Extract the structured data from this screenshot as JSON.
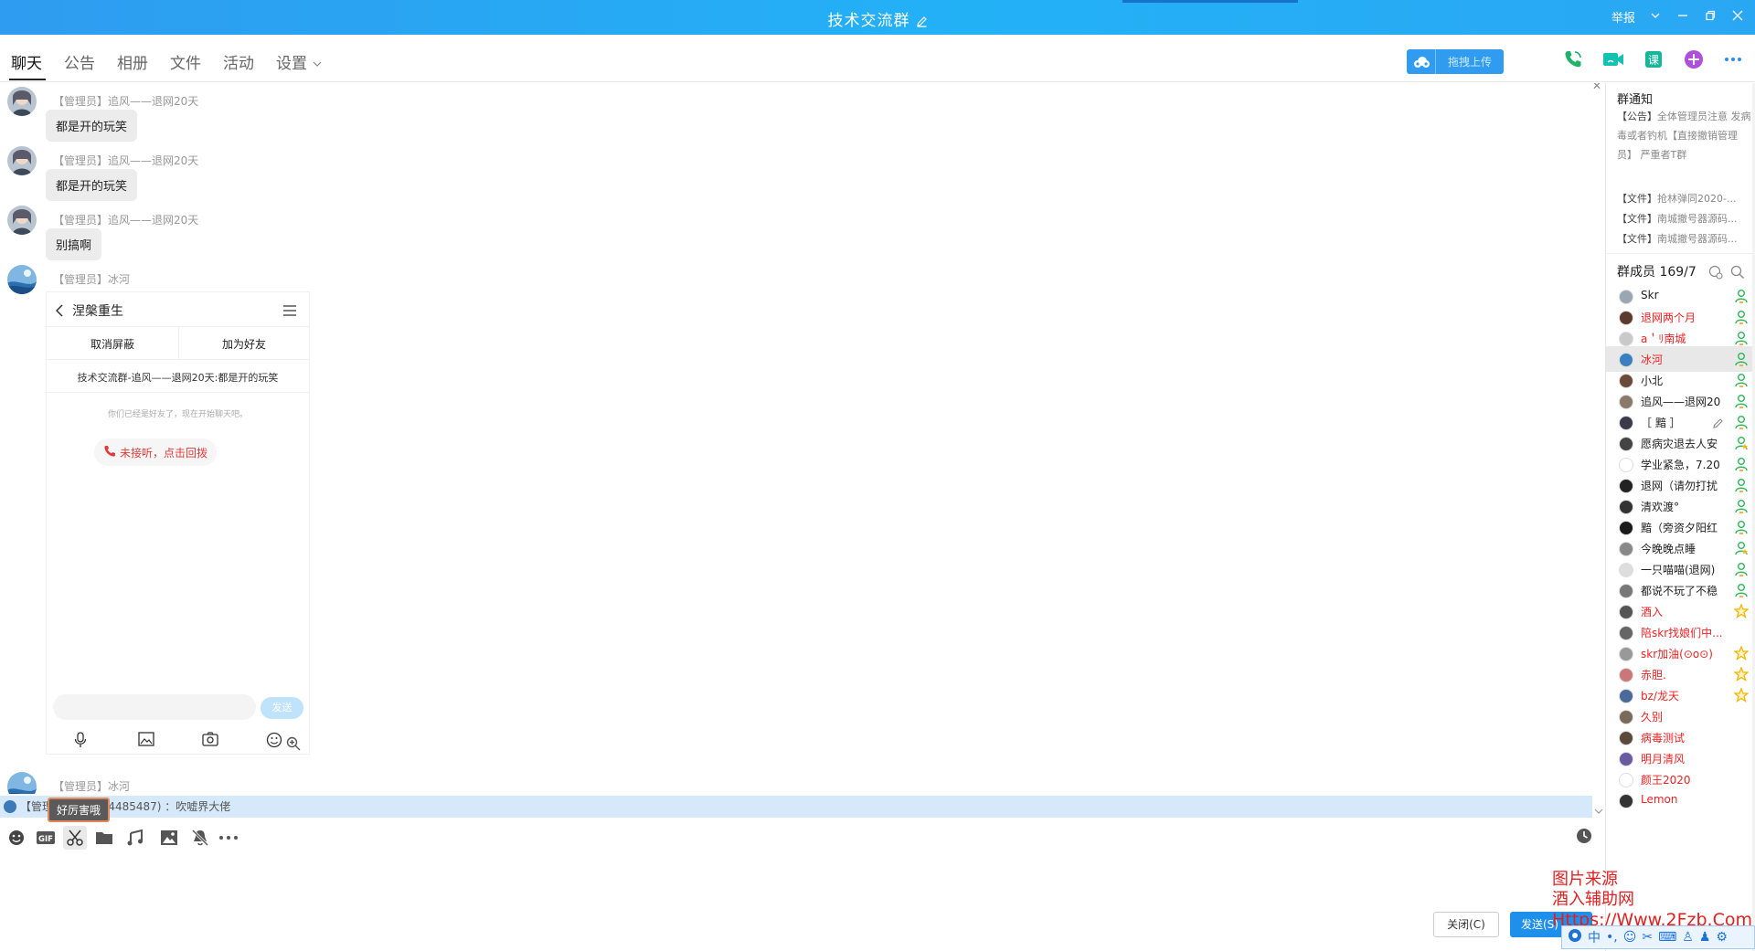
{
  "window": {
    "title": "技术交流群",
    "report_label": "举报",
    "colors": {
      "titlebar": "#2ba8f4",
      "accent": "#1e90ec",
      "red_text": "#e22222"
    }
  },
  "nav": {
    "tabs": [
      {
        "label": "聊天",
        "active": true
      },
      {
        "label": "公告",
        "active": false
      },
      {
        "label": "相册",
        "active": false
      },
      {
        "label": "文件",
        "active": false
      },
      {
        "label": "活动",
        "active": false
      },
      {
        "label": "设置",
        "active": false
      }
    ],
    "upload_label": "拖拽上传",
    "icons": [
      "phone-call-icon",
      "video-call-icon",
      "lesson-icon",
      "add-app-icon",
      "more-icon"
    ]
  },
  "messages": [
    {
      "sender": "【管理员】追风——退网20天",
      "text": "都是开的玩笑"
    },
    {
      "sender": "【管理员】追风——退网20天",
      "text": "都是开的玩笑"
    },
    {
      "sender": "【管理员】追风——退网20天",
      "text": "别搞啊"
    },
    {
      "sender": "【管理员】冰河",
      "text": ""
    }
  ],
  "screenshot_image": {
    "contact_name": "涅槃重生",
    "unblock_label": "取消屏蔽",
    "add_friend_label": "加为好友",
    "summary": "技术交流群-追风——退网20天:都是开的玩笑",
    "friend_notice": "你们已经是好友了，现在开始聊天吧。",
    "missed_call": "未接听，点击回拨",
    "send_label": "发送"
  },
  "last_message": {
    "sender": "【管理员】冰河"
  },
  "notice_bar": {
    "text": "【管理员】冰河(84485487) ：吹嘘界大佬"
  },
  "tooltip": {
    "text": "好厉害哦"
  },
  "toolbar": {
    "icons": [
      "emoji-icon",
      "gif-icon",
      "screenshot-scissors-icon",
      "folder-icon",
      "music-icon",
      "image-icon",
      "mute-bell-icon",
      "more-dots-icon"
    ],
    "gif_label": "GIF"
  },
  "buttons": {
    "close": "关闭(C)",
    "send": "发送(S)"
  },
  "sidebar": {
    "notice_title": "群通知",
    "announcement_head": "【公告】",
    "announcement_body": "全体管理员注意 发病毒或者钓机【直接撤销管理员】 严重者T群",
    "files": [
      {
        "head": "【文件】",
        "name": "抢林弹同2020-..."
      },
      {
        "head": "【文件】",
        "name": "南城撤号器源码..."
      },
      {
        "head": "【文件】",
        "name": "南城撤号器源码..."
      }
    ],
    "members_title": "群成员 169/7",
    "members": [
      {
        "name": "Skr",
        "red": false,
        "badge": "member",
        "avatar": "#9aa6b2"
      },
      {
        "name": "退网两个月",
        "red": true,
        "badge": "member",
        "avatar": "#5b3a2c"
      },
      {
        "name": "a＇ﾘ南城",
        "red": true,
        "badge": "member",
        "avatar": "#c9c9c9"
      },
      {
        "name": "冰河",
        "red": true,
        "badge": "member",
        "avatar": "#3a7fc0",
        "selected": true
      },
      {
        "name": "小北",
        "red": false,
        "badge": "member",
        "avatar": "#6b4a3a"
      },
      {
        "name": "追风——退网20",
        "red": false,
        "badge": "member",
        "avatar": "#8a7a6a"
      },
      {
        "name": "［ 黯 ］",
        "red": false,
        "badge": "member",
        "avatar": "#3a3a4a",
        "edit": true
      },
      {
        "name": "愿病灾退去人安",
        "red": false,
        "badge": "member-gold",
        "avatar": "#444"
      },
      {
        "name": "学业紧急，7.20",
        "red": false,
        "badge": "member",
        "avatar": "#ffffff"
      },
      {
        "name": "退网（请勿打扰",
        "red": false,
        "badge": "member",
        "avatar": "#222"
      },
      {
        "name": "清欢渡°",
        "red": false,
        "badge": "member",
        "avatar": "#333"
      },
      {
        "name": "黯（旁资夕阳红",
        "red": false,
        "badge": "member",
        "avatar": "#1a1a1a"
      },
      {
        "name": "今晚晚点睡",
        "red": false,
        "badge": "member-gold",
        "avatar": "#888"
      },
      {
        "name": "一只喵喵(退网)",
        "red": false,
        "badge": "member",
        "avatar": "#ddd"
      },
      {
        "name": "都说不玩了不稳",
        "red": false,
        "badge": "member",
        "avatar": "#777"
      },
      {
        "name": "酒入",
        "red": true,
        "badge": "star",
        "avatar": "#555"
      },
      {
        "name": "陪skr找娘们中...",
        "red": true,
        "badge": "none",
        "avatar": "#666"
      },
      {
        "name": "skr加油(⊙o⊙)",
        "red": true,
        "badge": "star",
        "avatar": "#999"
      },
      {
        "name": "赤胆.",
        "red": true,
        "badge": "star",
        "avatar": "#c77"
      },
      {
        "name": "bz/龙天",
        "red": true,
        "badge": "star",
        "avatar": "#4a6a9a"
      },
      {
        "name": "久别",
        "red": true,
        "badge": "none",
        "avatar": "#7a6a5a"
      },
      {
        "name": "病毒测试",
        "red": true,
        "badge": "none",
        "avatar": "#5a4a3a"
      },
      {
        "name": "明月清风",
        "red": true,
        "badge": "none",
        "avatar": "#6a5aa0"
      },
      {
        "name": "  颜王2020",
        "red": true,
        "badge": "none",
        "avatar": "#ffffff"
      },
      {
        "name": "Lemon",
        "red": true,
        "badge": "none",
        "avatar": "#333"
      }
    ]
  },
  "watermark": {
    "line1": "图片来源",
    "line2": "酒入辅助网",
    "url": "Https://Www.2Fzb.Com"
  },
  "ime": {
    "label": "中"
  }
}
